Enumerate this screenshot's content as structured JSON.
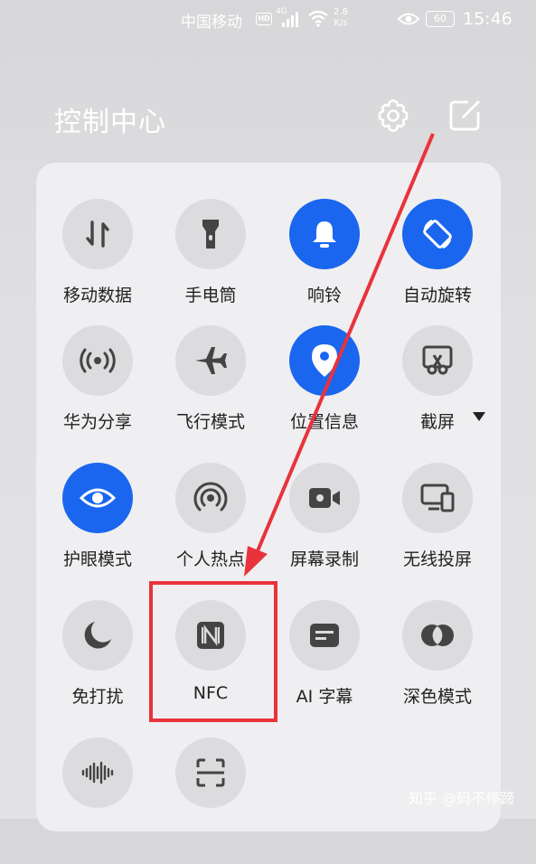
{
  "status_bar": {
    "carrier": "中国移动",
    "hd": "HD",
    "network_type": "4G",
    "speed_value": "2.8",
    "speed_unit": "K/s",
    "battery": "60",
    "time": "15:46"
  },
  "header": {
    "title": "控制中心",
    "settings_icon": "gear-icon",
    "edit_icon": "edit-icon"
  },
  "tiles": [
    {
      "label": "移动数据",
      "icon": "mobile-data-icon",
      "active": false
    },
    {
      "label": "手电筒",
      "icon": "flashlight-icon",
      "active": false
    },
    {
      "label": "响铃",
      "icon": "bell-icon",
      "active": true
    },
    {
      "label": "自动旋转",
      "icon": "rotate-icon",
      "active": true
    },
    {
      "label": "华为分享",
      "icon": "share-icon",
      "active": false
    },
    {
      "label": "飞行模式",
      "icon": "airplane-icon",
      "active": false
    },
    {
      "label": "位置信息",
      "icon": "location-icon",
      "active": true
    },
    {
      "label": "截屏",
      "icon": "screenshot-icon",
      "active": false
    },
    {
      "label": "护眼模式",
      "icon": "eye-icon",
      "active": true
    },
    {
      "label": "个人热点",
      "icon": "hotspot-icon",
      "active": false
    },
    {
      "label": "屏幕录制",
      "icon": "screen-record-icon",
      "active": false
    },
    {
      "label": "无线投屏",
      "icon": "cast-icon",
      "active": false
    },
    {
      "label": "免打扰",
      "icon": "moon-icon",
      "active": false
    },
    {
      "label": "NFC",
      "icon": "nfc-icon",
      "active": false
    },
    {
      "label": "AI 字幕",
      "icon": "subtitle-icon",
      "active": false
    },
    {
      "label": "深色模式",
      "icon": "dark-mode-icon",
      "active": false
    },
    {
      "label": "",
      "icon": "audio-wave-icon",
      "active": false
    },
    {
      "label": "",
      "icon": "scan-icon",
      "active": false
    }
  ],
  "colors": {
    "active": "#1a66ee",
    "inactive": "#dcdcde",
    "highlight": "#e8333b"
  },
  "watermark": "知乎 @码不停蹄"
}
